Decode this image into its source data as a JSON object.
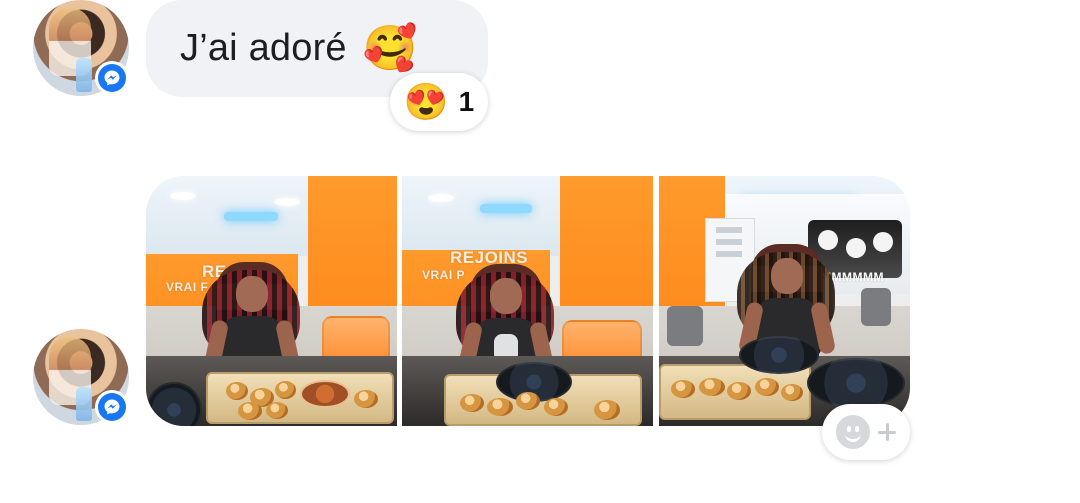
{
  "messages": {
    "text_message": {
      "text": "J’ai adoré",
      "emoji": "🥰",
      "reaction_emoji": "😍",
      "reaction_count": "1"
    },
    "photo_group": {
      "photo_1_sign_main": "REJ",
      "photo_1_sign_sub": "VRAI F",
      "photo_2_sign_main": "REJOINS",
      "photo_2_sign_sub": "VRAI P",
      "photo_3_mural_text": "MMMMMM"
    }
  },
  "icons": {
    "messenger": "messenger-icon",
    "add_reaction": "add-reaction-icon"
  },
  "colors": {
    "bubble_background": "#f0f2f5",
    "messenger_blue": "#1877f2",
    "reaction_pill": "#ffffff",
    "orange_accent": "#ff8c2f"
  }
}
